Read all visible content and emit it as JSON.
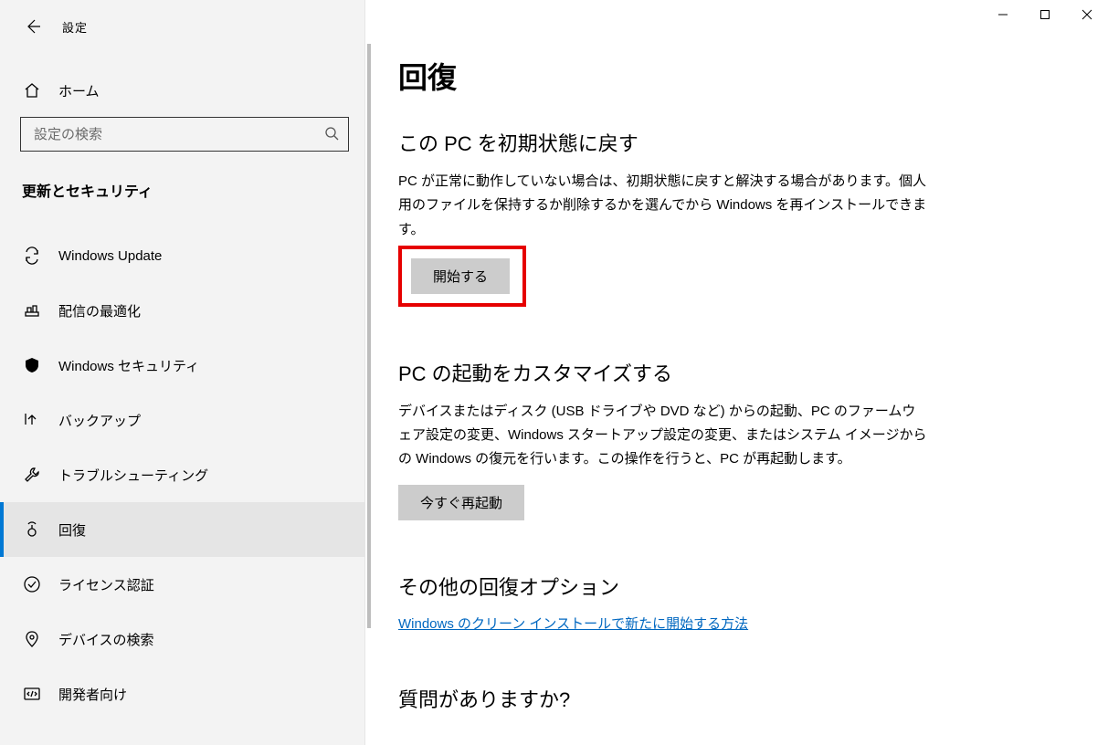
{
  "app_title": "設定",
  "home_label": "ホーム",
  "search_placeholder": "設定の検索",
  "category": "更新とセキュリティ",
  "nav": [
    {
      "key": "windows-update",
      "label": "Windows Update"
    },
    {
      "key": "delivery-opt",
      "label": "配信の最適化"
    },
    {
      "key": "windows-security",
      "label": "Windows セキュリティ"
    },
    {
      "key": "backup",
      "label": "バックアップ"
    },
    {
      "key": "troubleshoot",
      "label": "トラブルシューティング"
    },
    {
      "key": "recovery",
      "label": "回復",
      "selected": true
    },
    {
      "key": "activation",
      "label": "ライセンス認証"
    },
    {
      "key": "find-my-device",
      "label": "デバイスの検索"
    },
    {
      "key": "for-developers",
      "label": "開発者向け"
    }
  ],
  "page": {
    "title": "回復",
    "reset": {
      "heading": "この PC を初期状態に戻す",
      "body": "PC が正常に動作していない場合は、初期状態に戻すと解決する場合があります。個人用のファイルを保持するか削除するかを選んでから Windows を再インストールできます。",
      "button": "開始する"
    },
    "advanced": {
      "heading": "PC の起動をカスタマイズする",
      "body": "デバイスまたはディスク (USB ドライブや DVD など) からの起動、PC のファームウェア設定の変更、Windows スタートアップ設定の変更、またはシステム イメージからの Windows の復元を行います。この操作を行うと、PC が再起動します。",
      "button": "今すぐ再起動"
    },
    "more": {
      "heading": "その他の回復オプション",
      "link": "Windows のクリーン インストールで新たに開始する方法"
    },
    "questions": "質問がありますか?"
  }
}
